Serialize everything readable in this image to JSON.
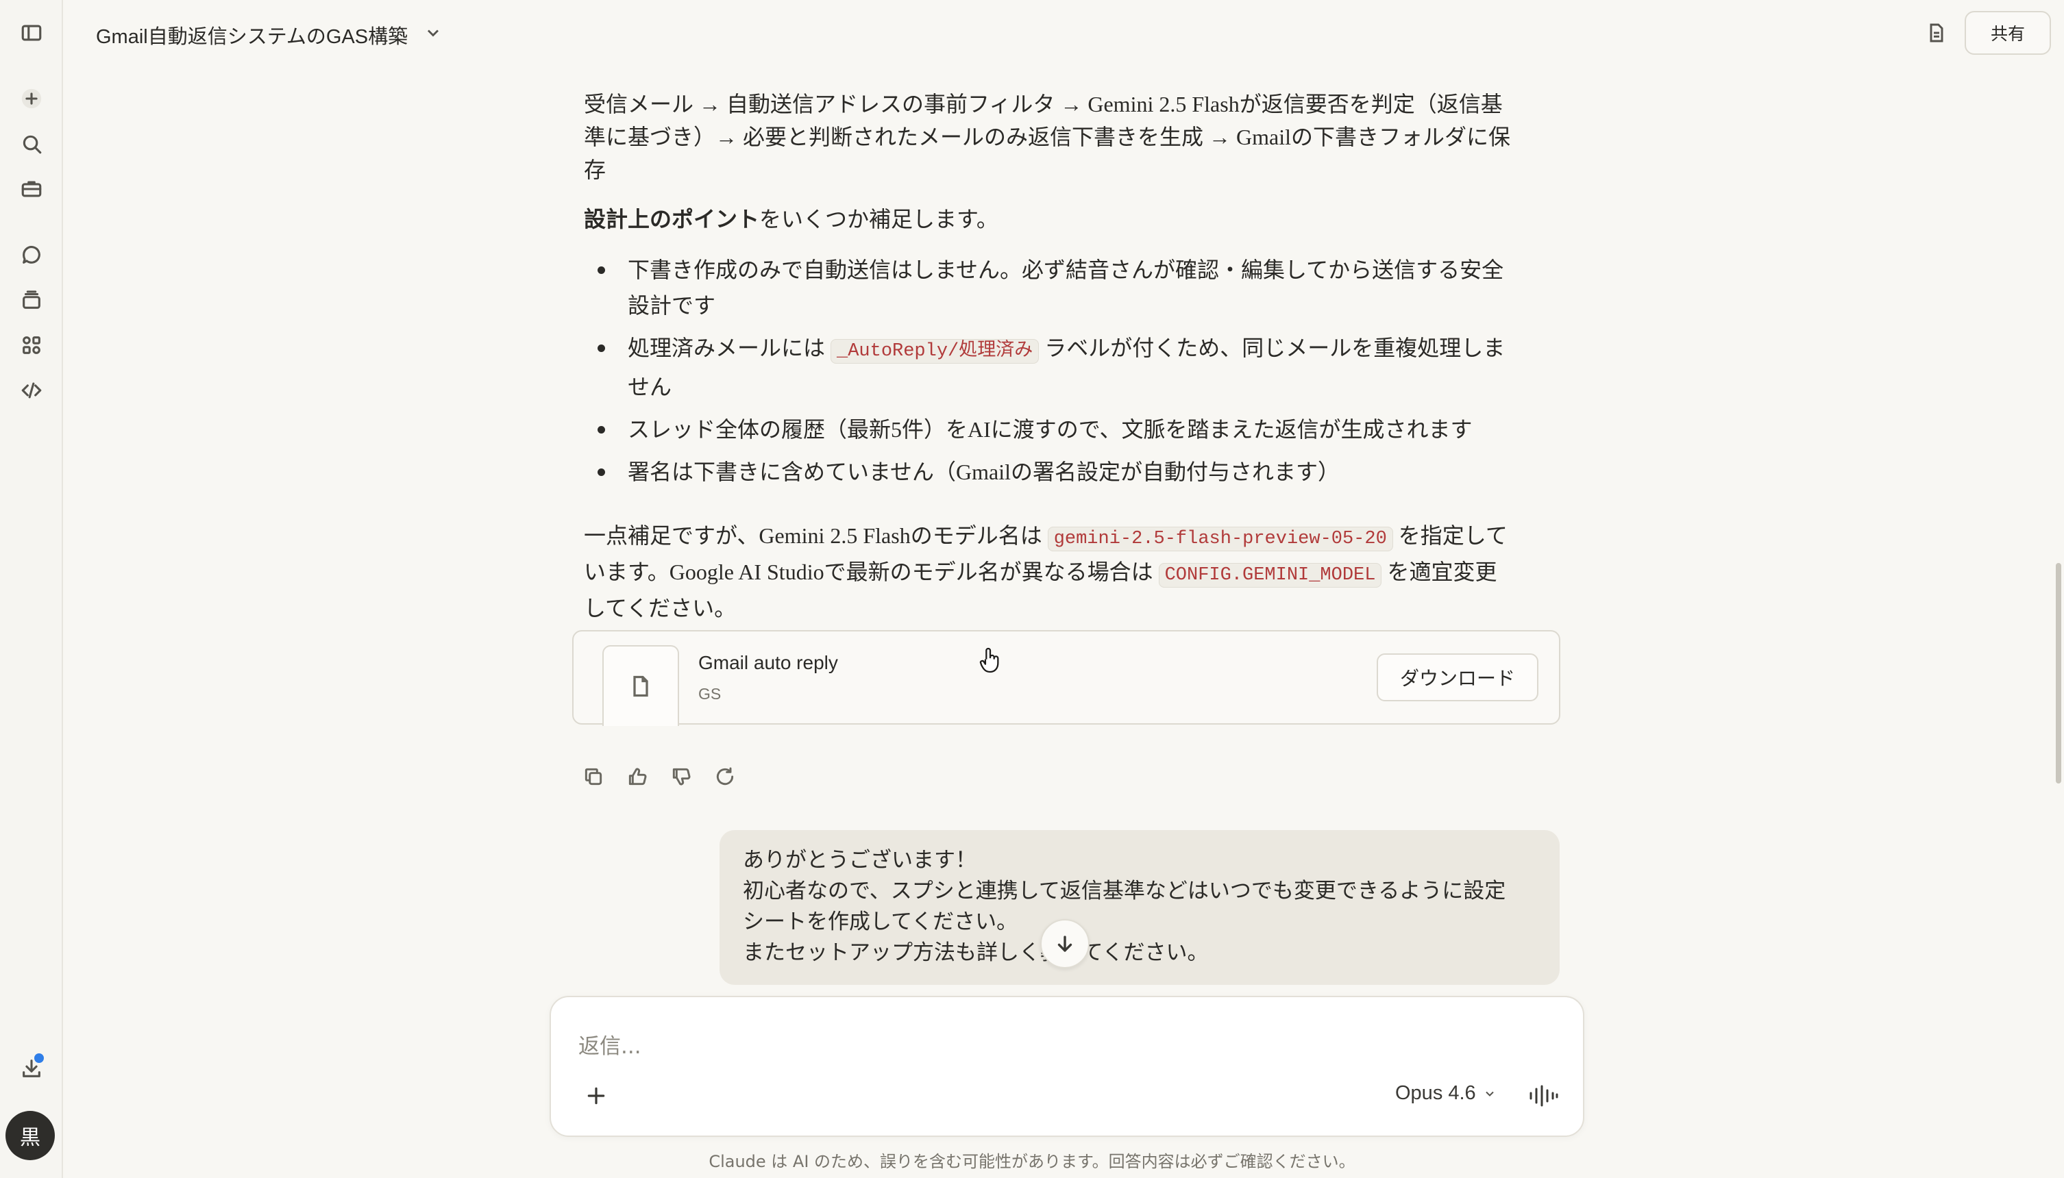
{
  "header": {
    "title": "Gmail自動返信システムのGAS構築",
    "share_label": "共有"
  },
  "sidebar": {
    "items": [
      {
        "icon": "sidebar-toggle-icon"
      },
      {
        "icon": "plus-icon"
      },
      {
        "icon": "search-icon"
      },
      {
        "icon": "briefcase-icon"
      },
      {
        "icon": "chats-icon"
      },
      {
        "icon": "projects-icon"
      },
      {
        "icon": "artifacts-icon"
      },
      {
        "icon": "code-icon"
      },
      {
        "icon": "download-icon"
      }
    ],
    "avatar_initial": "黒"
  },
  "assistant": {
    "flow": "受信メール → 自動送信アドレスの事前フィルタ → Gemini 2.5 Flashが返信要否を判定（返信基準に基づき）→ 必要と判断されたメールのみ返信下書きを生成 → Gmailの下書きフォルダに保存",
    "design_bold": "設計上のポイント",
    "design_rest": "をいくつか補足します。",
    "bullets": {
      "b1": "下書き作成のみで自動送信はしません。必ず結音さんが確認・編集してから送信する安全設計です",
      "b2_pre": "処理済みメールには ",
      "b2_code": "_AutoReply/処理済み",
      "b2_post": " ラベルが付くため、同じメールを重複処理しません",
      "b3": "スレッド全体の履歴（最新5件）をAIに渡すので、文脈を踏まえた返信が生成されます",
      "b4": "署名は下書きに含めていません（Gmailの署名設定が自動付与されます）"
    },
    "note": {
      "pre": "一点補足ですが、Gemini 2.5 Flashのモデル名は ",
      "code1": "gemini-2.5-flash-preview-05-20",
      "mid": " を指定しています。Google AI Studioで最新のモデル名が異なる場合は ",
      "code2": "CONFIG.GEMINI_MODEL",
      "post": " を適宜変更してください。"
    }
  },
  "file_card": {
    "name": "Gmail auto reply",
    "type": "GS",
    "download_label": "ダウンロード"
  },
  "user_message": {
    "line1": "ありがとうございます！",
    "line2": "初心者なので、スプシと連携して返信基準などはいつでも変更できるように設定",
    "line3": "シートを作成してください。",
    "line4": "またセットアップ方法も詳しく教えてください。"
  },
  "composer": {
    "placeholder": "返信...",
    "model": "Opus 4.6"
  },
  "disclaimer": "Claude は AI のため、誤りを含む可能性があります。回答内容は必ずご確認ください。",
  "colors": {
    "background": "#f8f7f3",
    "code_text": "#b13a3a",
    "user_bubble": "#ebe8e0",
    "notification_dot": "#2f7ee8"
  }
}
